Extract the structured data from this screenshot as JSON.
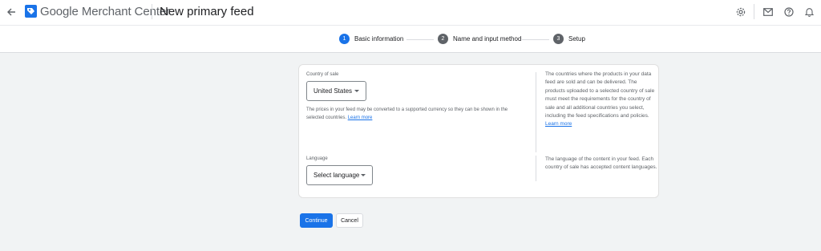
{
  "header": {
    "brand": "Google Merchant Center",
    "title": "New primary feed",
    "icons": [
      "arrow-back-icon",
      "merchant-center-logo",
      "settings-icon",
      "mail-icon",
      "help-icon",
      "notifications-icon"
    ]
  },
  "stepper": {
    "steps": [
      {
        "num": "1",
        "label": "Basic information",
        "state": "active"
      },
      {
        "num": "2",
        "label": "Name and input method",
        "state": "inactive"
      },
      {
        "num": "3",
        "label": "Setup",
        "state": "inactive"
      }
    ]
  },
  "form": {
    "country": {
      "label": "Country of sale",
      "value": "United States",
      "hint": "The prices in your feed may be converted to a supported currency so they can be shown in the selected countries.",
      "learn_more": "Learn more",
      "side_text": "The countries where the products in your data feed are sold and can be delivered. The products uploaded to a selected country of sale must meet the requirements for the country of sale and all additional countries you select, including the feed specifications and policies.",
      "side_learn_more": "Learn more"
    },
    "language": {
      "label": "Language",
      "value": "Select language",
      "side_text": "The language of the content in your feed. Each country of sale has accepted content languages."
    }
  },
  "actions": {
    "continue_label": "Continue",
    "cancel_label": "Cancel"
  },
  "colors": {
    "accent": "#1a73e8",
    "background": "#f1f3f4"
  }
}
